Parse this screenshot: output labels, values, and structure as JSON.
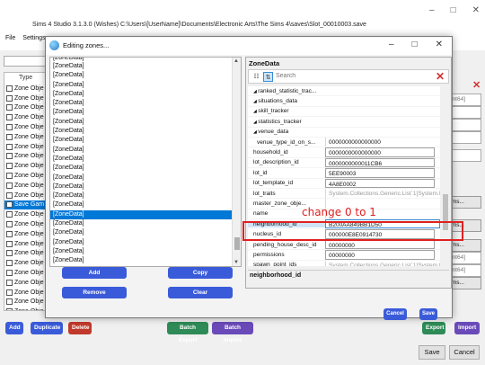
{
  "main_window": {
    "title": "Sims 4 Studio 3.1.3.0 (Wishes)  C:\\Users\\[UserName]\\Documents\\Electronic Arts\\The Sims 4\\saves\\Slot_00010003.save",
    "controls": [
      "–",
      "□",
      "✕"
    ],
    "menu": [
      "File",
      "Settings"
    ],
    "table_header": "Type",
    "rows": [
      {
        "label": "Zone Obje",
        "selected": false
      },
      {
        "label": "Zone Obje",
        "selected": false
      },
      {
        "label": "Zone Obje",
        "selected": false
      },
      {
        "label": "Zone Obje",
        "selected": false
      },
      {
        "label": "Zone Obje",
        "selected": false
      },
      {
        "label": "Zone Obje",
        "selected": false
      },
      {
        "label": "Zone Obje",
        "selected": false
      },
      {
        "label": "Zone Obje",
        "selected": false
      },
      {
        "label": "Zone Obje",
        "selected": false
      },
      {
        "label": "Zone Obje",
        "selected": false
      },
      {
        "label": "Zone Obje",
        "selected": false
      },
      {
        "label": "Zone Obje",
        "selected": false
      },
      {
        "label": "Save Gam",
        "selected": true
      },
      {
        "label": "Zone Obje",
        "selected": false
      },
      {
        "label": "Zone Obje",
        "selected": false
      },
      {
        "label": "Zone Obje",
        "selected": false
      },
      {
        "label": "Zone Obje",
        "selected": false
      },
      {
        "label": "Zone Obje",
        "selected": false
      },
      {
        "label": "Zone Obje",
        "selected": false
      },
      {
        "label": "Zone Obje",
        "selected": false
      },
      {
        "label": "Zone Obje",
        "selected": false
      },
      {
        "label": "Zone Obje",
        "selected": false
      },
      {
        "label": "Zone Obje",
        "selected": false
      },
      {
        "label": "Zone Obje",
        "selected": false
      }
    ],
    "right_col": {
      "uint_1": "s.UInt64]",
      "items_1": "t Items...",
      "items_2": "t Items...",
      "items_3": "t Items...",
      "uint_2": "s.UInt64]",
      "uint_3": "s.UInt64]",
      "items_4": "t Items..."
    },
    "bottom_buttons": {
      "add": "Add",
      "duplicate": "Duplicate",
      "delete": "Delete",
      "batch_export": "Batch Export",
      "batch_import": "Batch Import",
      "export": "Export",
      "import": "Import"
    },
    "footer": {
      "save": "Save",
      "cancel": "Cancel"
    }
  },
  "dialog": {
    "title": "Editing zones...",
    "controls": [
      "–",
      "□",
      "✕"
    ],
    "zones": [
      "[ZoneData]",
      "[ZoneData]",
      "[ZoneData]",
      "[ZoneData]",
      "[ZoneData]",
      "[ZoneData]",
      "[ZoneData]",
      "[ZoneData]",
      "[ZoneData]",
      "[ZoneData]",
      "[ZoneData]",
      "[ZoneData]",
      "[ZoneData]",
      "[ZoneData]",
      "[ZoneData]",
      "[ZoneData]",
      "[ZoneData]",
      "[ZoneData]",
      "[ZoneData]",
      "[ZoneData]",
      "[ZoneData]",
      "[ZoneData]",
      "[ZoneData]"
    ],
    "selected_zone_index": 17,
    "buttons": {
      "add": "Add",
      "copy": "Copy",
      "remove": "Remove",
      "clear": "Clear",
      "cancel": "Cancel",
      "save": "Save"
    },
    "property_grid": {
      "title": "ZoneData",
      "search_placeholder": "Search",
      "rows": [
        {
          "name": "ranked_statistic_trac...",
          "value": "",
          "style": "expand"
        },
        {
          "name": "situations_data",
          "value": "",
          "style": "expand"
        },
        {
          "name": "skill_tracker",
          "value": "",
          "style": "expand"
        },
        {
          "name": "statistics_tracker",
          "value": "",
          "style": "expand"
        },
        {
          "name": "venue_data",
          "value": "",
          "style": "expand"
        },
        {
          "name": "venue_type_id_on_s...",
          "value": "0000000000000000",
          "style": "sub"
        },
        {
          "name": "household_id",
          "value": "0000000000000000",
          "style": "box"
        },
        {
          "name": "lot_description_id",
          "value": "0000000000011CB6",
          "style": "box"
        },
        {
          "name": "lot_id",
          "value": "5EE90003",
          "style": "box"
        },
        {
          "name": "lot_template_id",
          "value": "4A8E0002",
          "style": "box"
        },
        {
          "name": "lot_traits",
          "value": "System.Collections.Generic.List`1[System.I",
          "style": "gray"
        },
        {
          "name": "master_zone_obje...",
          "value": "",
          "style": "plain"
        },
        {
          "name": "name",
          "value": "",
          "style": "plain"
        },
        {
          "name": "neighborhood_id",
          "value": "B200AA849BB1D50",
          "style": "selected"
        },
        {
          "name": "nucleus_id",
          "value": "000000E8E0914730",
          "style": "box"
        },
        {
          "name": "pending_house_desc_id",
          "value": "00000000",
          "style": "box"
        },
        {
          "name": "permissions",
          "value": "00000000",
          "style": "box"
        },
        {
          "name": "spawn_point_ids",
          "value": "System.Collections.Generic.List`1[System.I",
          "style": "gray"
        }
      ],
      "description": "neighborhood_id"
    }
  },
  "annotation": {
    "text": "change 0 to 1",
    "color": "#e02020"
  },
  "colors": {
    "accent_blue": "#3a5bd9",
    "selection": "#0078d7",
    "delete_red": "#c0392b",
    "batch_green": "#2e8b57"
  }
}
